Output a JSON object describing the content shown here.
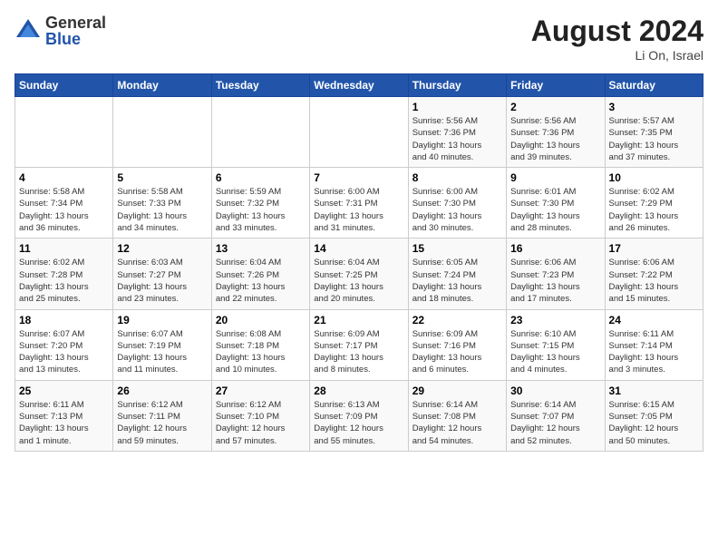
{
  "logo": {
    "general": "General",
    "blue": "Blue"
  },
  "header": {
    "month_year": "August 2024",
    "location": "Li On, Israel"
  },
  "days_of_week": [
    "Sunday",
    "Monday",
    "Tuesday",
    "Wednesday",
    "Thursday",
    "Friday",
    "Saturday"
  ],
  "weeks": [
    [
      {
        "day": "",
        "info": ""
      },
      {
        "day": "",
        "info": ""
      },
      {
        "day": "",
        "info": ""
      },
      {
        "day": "",
        "info": ""
      },
      {
        "day": "1",
        "info": "Sunrise: 5:56 AM\nSunset: 7:36 PM\nDaylight: 13 hours\nand 40 minutes."
      },
      {
        "day": "2",
        "info": "Sunrise: 5:56 AM\nSunset: 7:36 PM\nDaylight: 13 hours\nand 39 minutes."
      },
      {
        "day": "3",
        "info": "Sunrise: 5:57 AM\nSunset: 7:35 PM\nDaylight: 13 hours\nand 37 minutes."
      }
    ],
    [
      {
        "day": "4",
        "info": "Sunrise: 5:58 AM\nSunset: 7:34 PM\nDaylight: 13 hours\nand 36 minutes."
      },
      {
        "day": "5",
        "info": "Sunrise: 5:58 AM\nSunset: 7:33 PM\nDaylight: 13 hours\nand 34 minutes."
      },
      {
        "day": "6",
        "info": "Sunrise: 5:59 AM\nSunset: 7:32 PM\nDaylight: 13 hours\nand 33 minutes."
      },
      {
        "day": "7",
        "info": "Sunrise: 6:00 AM\nSunset: 7:31 PM\nDaylight: 13 hours\nand 31 minutes."
      },
      {
        "day": "8",
        "info": "Sunrise: 6:00 AM\nSunset: 7:30 PM\nDaylight: 13 hours\nand 30 minutes."
      },
      {
        "day": "9",
        "info": "Sunrise: 6:01 AM\nSunset: 7:30 PM\nDaylight: 13 hours\nand 28 minutes."
      },
      {
        "day": "10",
        "info": "Sunrise: 6:02 AM\nSunset: 7:29 PM\nDaylight: 13 hours\nand 26 minutes."
      }
    ],
    [
      {
        "day": "11",
        "info": "Sunrise: 6:02 AM\nSunset: 7:28 PM\nDaylight: 13 hours\nand 25 minutes."
      },
      {
        "day": "12",
        "info": "Sunrise: 6:03 AM\nSunset: 7:27 PM\nDaylight: 13 hours\nand 23 minutes."
      },
      {
        "day": "13",
        "info": "Sunrise: 6:04 AM\nSunset: 7:26 PM\nDaylight: 13 hours\nand 22 minutes."
      },
      {
        "day": "14",
        "info": "Sunrise: 6:04 AM\nSunset: 7:25 PM\nDaylight: 13 hours\nand 20 minutes."
      },
      {
        "day": "15",
        "info": "Sunrise: 6:05 AM\nSunset: 7:24 PM\nDaylight: 13 hours\nand 18 minutes."
      },
      {
        "day": "16",
        "info": "Sunrise: 6:06 AM\nSunset: 7:23 PM\nDaylight: 13 hours\nand 17 minutes."
      },
      {
        "day": "17",
        "info": "Sunrise: 6:06 AM\nSunset: 7:22 PM\nDaylight: 13 hours\nand 15 minutes."
      }
    ],
    [
      {
        "day": "18",
        "info": "Sunrise: 6:07 AM\nSunset: 7:20 PM\nDaylight: 13 hours\nand 13 minutes."
      },
      {
        "day": "19",
        "info": "Sunrise: 6:07 AM\nSunset: 7:19 PM\nDaylight: 13 hours\nand 11 minutes."
      },
      {
        "day": "20",
        "info": "Sunrise: 6:08 AM\nSunset: 7:18 PM\nDaylight: 13 hours\nand 10 minutes."
      },
      {
        "day": "21",
        "info": "Sunrise: 6:09 AM\nSunset: 7:17 PM\nDaylight: 13 hours\nand 8 minutes."
      },
      {
        "day": "22",
        "info": "Sunrise: 6:09 AM\nSunset: 7:16 PM\nDaylight: 13 hours\nand 6 minutes."
      },
      {
        "day": "23",
        "info": "Sunrise: 6:10 AM\nSunset: 7:15 PM\nDaylight: 13 hours\nand 4 minutes."
      },
      {
        "day": "24",
        "info": "Sunrise: 6:11 AM\nSunset: 7:14 PM\nDaylight: 13 hours\nand 3 minutes."
      }
    ],
    [
      {
        "day": "25",
        "info": "Sunrise: 6:11 AM\nSunset: 7:13 PM\nDaylight: 13 hours\nand 1 minute."
      },
      {
        "day": "26",
        "info": "Sunrise: 6:12 AM\nSunset: 7:11 PM\nDaylight: 12 hours\nand 59 minutes."
      },
      {
        "day": "27",
        "info": "Sunrise: 6:12 AM\nSunset: 7:10 PM\nDaylight: 12 hours\nand 57 minutes."
      },
      {
        "day": "28",
        "info": "Sunrise: 6:13 AM\nSunset: 7:09 PM\nDaylight: 12 hours\nand 55 minutes."
      },
      {
        "day": "29",
        "info": "Sunrise: 6:14 AM\nSunset: 7:08 PM\nDaylight: 12 hours\nand 54 minutes."
      },
      {
        "day": "30",
        "info": "Sunrise: 6:14 AM\nSunset: 7:07 PM\nDaylight: 12 hours\nand 52 minutes."
      },
      {
        "day": "31",
        "info": "Sunrise: 6:15 AM\nSunset: 7:05 PM\nDaylight: 12 hours\nand 50 minutes."
      }
    ]
  ]
}
